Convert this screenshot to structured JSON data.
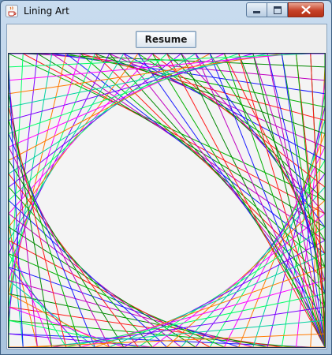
{
  "window": {
    "title": "Lining Art",
    "icon": "java-cup-icon"
  },
  "controls": {
    "resume_label": "Resume"
  },
  "palette": [
    "#ff1a1a",
    "#ff7a00",
    "#00b000",
    "#00d0a0",
    "#1a1aff",
    "#7a00ff",
    "#c000c0",
    "#00ff66",
    "#008800",
    "#ff00ff"
  ]
}
